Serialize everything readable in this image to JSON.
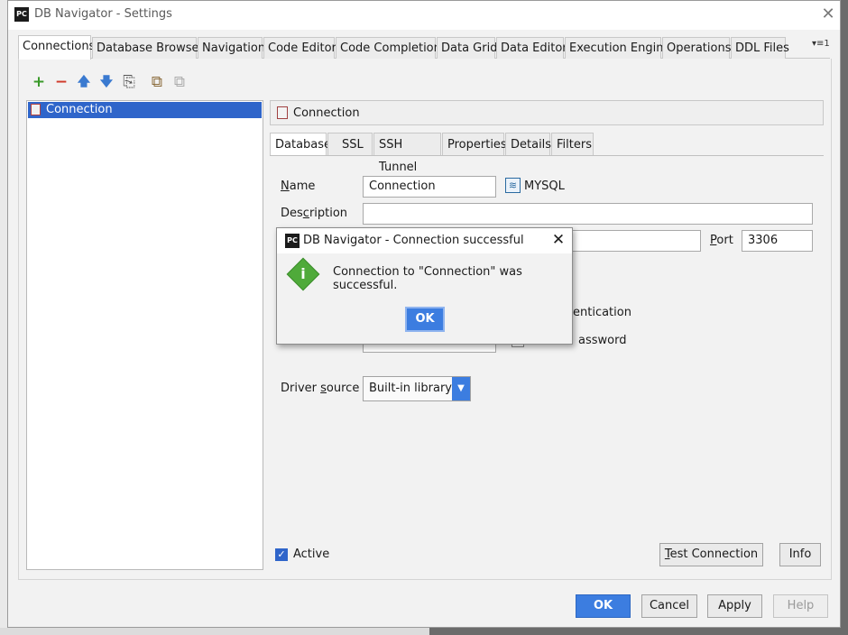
{
  "window": {
    "title": "DB Navigator - Settings",
    "app_icon": "PC"
  },
  "tabs": [
    {
      "label": "Connections"
    },
    {
      "label": "Database Browser"
    },
    {
      "label": "Navigation"
    },
    {
      "label": "Code Editor"
    },
    {
      "label": "Code Completion"
    },
    {
      "label": "Data Grid"
    },
    {
      "label": "Data Editor"
    },
    {
      "label": "Execution Engine"
    },
    {
      "label": "Operations"
    },
    {
      "label": "DDL Files"
    }
  ],
  "tabs_overflow": "▾≡1",
  "toolbar": {
    "add": "+",
    "remove": "−",
    "move_up": "🡅",
    "move_down": "🡇",
    "copy": "⎘",
    "paste": "⧉",
    "paste2": "⧉"
  },
  "tree": {
    "items": [
      {
        "label": "Connection"
      }
    ]
  },
  "connection_header": {
    "label": "Connection"
  },
  "subtabs": [
    {
      "label": "Database"
    },
    {
      "label": "SSL"
    },
    {
      "label": "SSH Tunnel"
    },
    {
      "label": "Properties"
    },
    {
      "label": "Details"
    },
    {
      "label": "Filters"
    }
  ],
  "form": {
    "name_label_u": "N",
    "name_label_rest": "ame",
    "name_value": "Connection",
    "db_type": "MYSQL",
    "description_label_pre": "Des",
    "description_label_u": "c",
    "description_label_rest": "ription",
    "description_value": "",
    "host_value": "",
    "port_label_u": "P",
    "port_label_rest": "ort",
    "port_value": "3306",
    "auth_fragment": "entication",
    "password_fragment": "assword",
    "driver_source_label_pre": "Driver ",
    "driver_source_label_u": "s",
    "driver_source_label_rest": "ource",
    "driver_source_value": "Built-in library"
  },
  "bottom": {
    "active_label": "Active",
    "test_connection_u": "T",
    "test_connection_rest": "est Connection",
    "info": "Info",
    "ok": "OK",
    "cancel": "Cancel",
    "apply": "Apply",
    "help": "Help"
  },
  "modal": {
    "title": "DB Navigator - Connection successful",
    "message": "Connection to \"Connection\" was successful.",
    "ok": "OK"
  },
  "colors": {
    "accent": "#3c7de0",
    "selection": "#2f65ca",
    "success_icon": "#4faa3a"
  }
}
